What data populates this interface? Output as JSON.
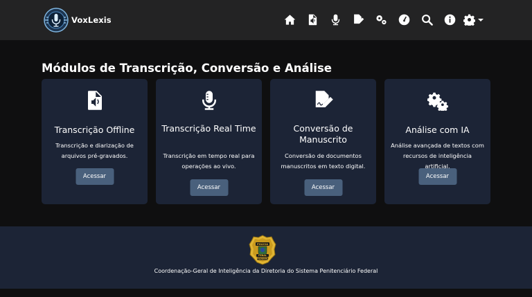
{
  "brand": {
    "name": "VoxLexis"
  },
  "nav": {
    "icons": [
      "home-icon",
      "audio-file-icon",
      "microphone-icon",
      "signature-icon",
      "gears-icon",
      "dashboard-icon",
      "search-icon",
      "info-icon",
      "settings-icon"
    ]
  },
  "page": {
    "title": "Módulos de Transcrição, Conversão e Análise"
  },
  "cards": [
    {
      "title": "Transcrição Offline",
      "description": "Transcrição e diarização de arquivos pré-gravados.",
      "button": "Acessar",
      "icon": "audio-file-icon"
    },
    {
      "title": "Transcrição Real Time",
      "description": "Transcrição em tempo real para operações ao vivo.",
      "button": "Acessar",
      "icon": "microphone-icon"
    },
    {
      "title": "Conversão de Manuscrito",
      "description": "Conversão de documentos manuscritos em texto digital.",
      "button": "Acessar",
      "icon": "signature-file-icon"
    },
    {
      "title": "Análise com IA",
      "description": "Análise avançada de textos com recursos de inteligência artificial.",
      "button": "Acessar",
      "icon": "gears-icon"
    }
  ],
  "footer": {
    "text": "Coordenação-Geral de Inteligência da Diretoria do Sistema Penitenciário Federal",
    "badge_text": [
      "POLÍCIA",
      "PENAL",
      "FEDERAL"
    ]
  },
  "colors": {
    "navbar": "#232324",
    "background": "#0f0f10",
    "card": "#1c2436",
    "button": "#49607c",
    "footer": "#1c2436"
  }
}
